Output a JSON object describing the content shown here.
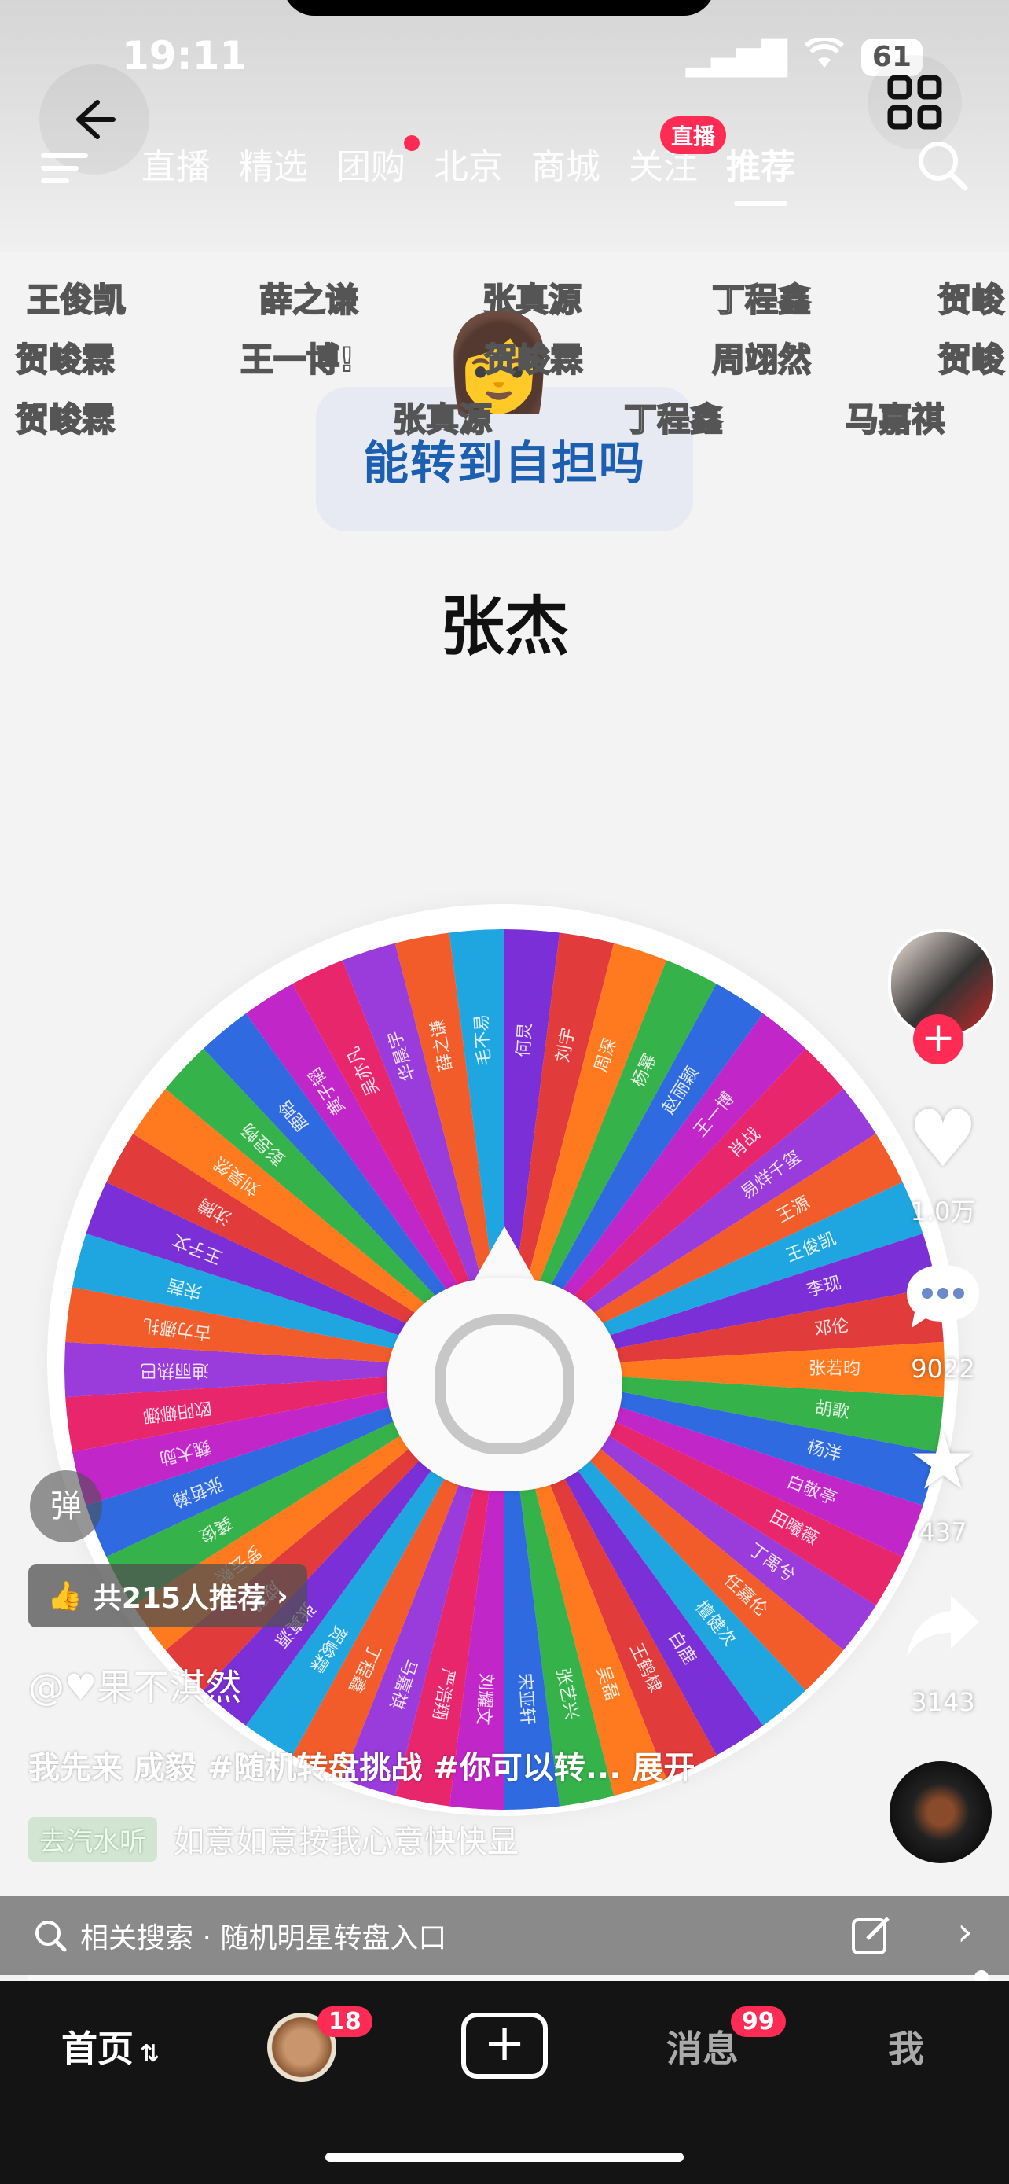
{
  "status": {
    "time": "19:11",
    "battery": "61"
  },
  "nav": {
    "tabs": [
      {
        "label": "直播"
      },
      {
        "label": "精选"
      },
      {
        "label": "团购"
      },
      {
        "label": "北京"
      },
      {
        "label": "商城"
      },
      {
        "label": "关注"
      },
      {
        "label": "推荐"
      }
    ],
    "live_badge": "直播"
  },
  "danmaku": {
    "row1": [
      "王俊凯",
      "薛之谦",
      "张真源",
      "丁程鑫",
      "贺峻"
    ],
    "row2": [
      "贺峻霖",
      "王一博!",
      "贺峻霖",
      "周翊然",
      "贺峻"
    ],
    "row3": [
      "贺峻霖",
      "张真源",
      "丁程鑫",
      "马嘉祺"
    ]
  },
  "card": {
    "question": "能转到自担吗"
  },
  "result_name": "张杰",
  "wheel": {
    "labels": [
      "何炅",
      "刘宇",
      "周深",
      "杨幂",
      "赵丽颖",
      "王一博",
      "肖战",
      "易烊千玺",
      "王源",
      "王俊凯",
      "李现",
      "邓伦",
      "张若昀",
      "胡歌",
      "杨洋",
      "白敬亭",
      "田曦薇",
      "丁禹兮",
      "任嘉伦",
      "檀健次",
      "白鹿",
      "王鹤棣",
      "吴磊",
      "张艺兴",
      "宋亚轩",
      "刘耀文",
      "严浩翔",
      "马嘉祺",
      "丁程鑫",
      "贺峻霖",
      "张真源",
      "成毅",
      "罗云熙",
      "龚俊",
      "张哲瀚",
      "魏大勋",
      "欧阳娜娜",
      "迪丽热巴",
      "古力娜扎",
      "宋茜",
      "王子文",
      "沈腾",
      "刘昊然",
      "彭昱畅",
      "鹿晗",
      "黄子韬",
      "吴亦凡",
      "华晨宇",
      "薛之谦",
      "毛不易"
    ],
    "colors": [
      "#7b2fd6",
      "#e23b3b",
      "#ff7a1f",
      "#36b24a",
      "#2f6ae0",
      "#c126c9",
      "#e8266b",
      "#9a3bdb",
      "#f25c2a",
      "#1fa6e0"
    ]
  },
  "rail": {
    "likes": "1.0万",
    "comments": "9022",
    "favorites": "437",
    "shares": "3143"
  },
  "left": {
    "danmu_toggle": "弹",
    "recommend": "共215人推荐",
    "author": "@♥果不淇然",
    "caption": "我先来  成毅 #随机转盘挑战 #你可以转... 展开",
    "music_tag": "去汽水听",
    "music_title": "如意如意按我心意快快显"
  },
  "related_search": {
    "label": "相关搜索 · 随机明星转盘入口"
  },
  "tabbar": {
    "home": "首页",
    "friends_badge": "18",
    "messages": "消息",
    "messages_badge": "99",
    "me": "我"
  }
}
